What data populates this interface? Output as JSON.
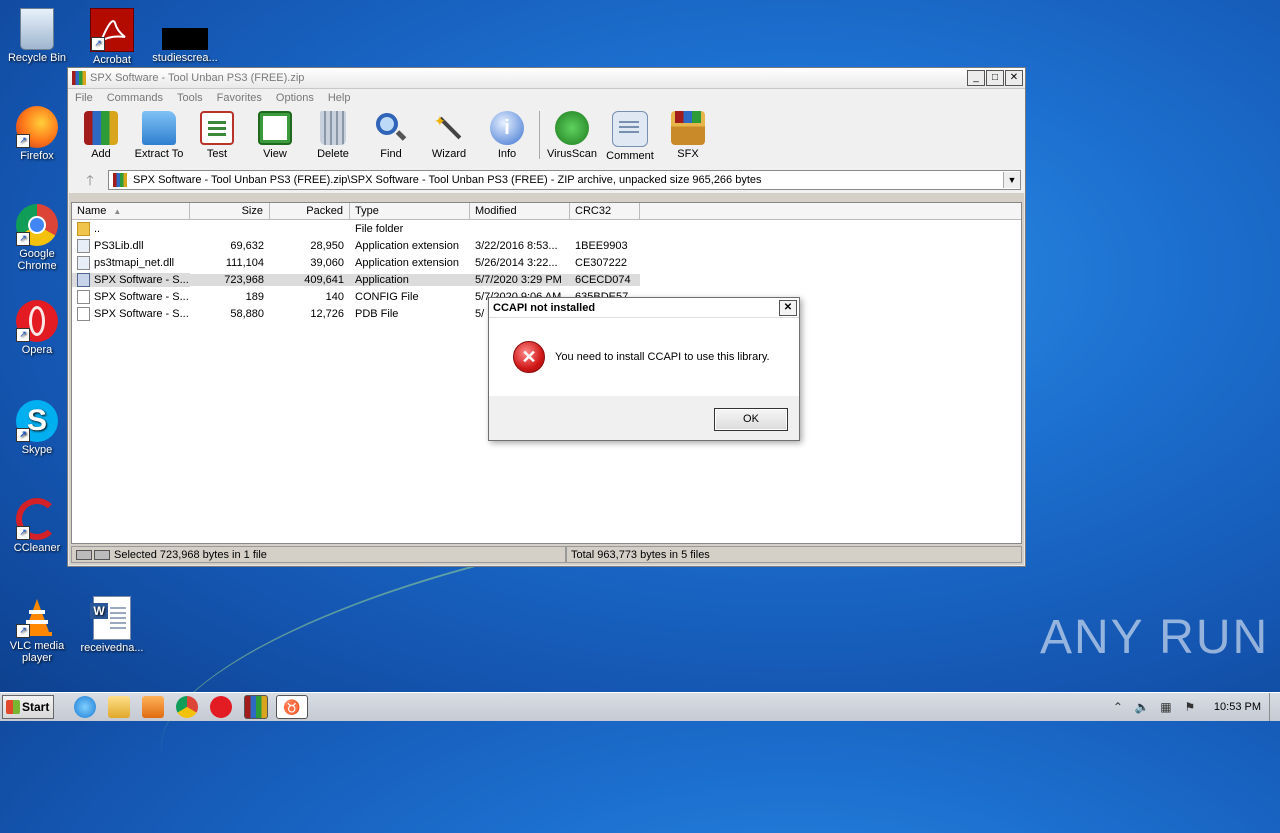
{
  "desktop": {
    "icons": [
      {
        "label": "Recycle Bin"
      },
      {
        "label": "Acrobat"
      },
      {
        "label": "studiescrea..."
      },
      {
        "label": "Firefox"
      },
      {
        "label": "Google Chrome"
      },
      {
        "label": "Opera"
      },
      {
        "label": "Skype"
      },
      {
        "label": "CCleaner"
      },
      {
        "label": "VLC media player"
      },
      {
        "label": "receivedna..."
      }
    ],
    "watermark": "ANY RUN"
  },
  "window": {
    "title": "SPX Software - Tool Unban PS3 (FREE).zip",
    "menu": [
      "File",
      "Commands",
      "Tools",
      "Favorites",
      "Options",
      "Help"
    ],
    "toolbar": [
      "Add",
      "Extract To",
      "Test",
      "View",
      "Delete",
      "Find",
      "Wizard",
      "Info",
      "VirusScan",
      "Comment",
      "SFX"
    ],
    "address": "SPX Software - Tool Unban PS3 (FREE).zip\\SPX Software - Tool Unban PS3 (FREE) - ZIP archive, unpacked size 965,266 bytes",
    "columns": [
      "Name",
      "Size",
      "Packed",
      "Type",
      "Modified",
      "CRC32"
    ],
    "rows": [
      {
        "name": "..",
        "size": "",
        "packed": "",
        "type": "File folder",
        "modified": "",
        "crc": ""
      },
      {
        "name": "PS3Lib.dll",
        "size": "69,632",
        "packed": "28,950",
        "type": "Application extension",
        "modified": "3/22/2016 8:53...",
        "crc": "1BEE9903"
      },
      {
        "name": "ps3tmapi_net.dll",
        "size": "111,104",
        "packed": "39,060",
        "type": "Application extension",
        "modified": "5/26/2014 3:22...",
        "crc": "CE307222"
      },
      {
        "name": "SPX Software - S...",
        "size": "723,968",
        "packed": "409,641",
        "type": "Application",
        "modified": "5/7/2020 3:29 PM",
        "crc": "6CECD074"
      },
      {
        "name": "SPX Software - S...",
        "size": "189",
        "packed": "140",
        "type": "CONFIG File",
        "modified": "5/7/2020 9:06 AM",
        "crc": "635BDE57"
      },
      {
        "name": "SPX Software - S...",
        "size": "58,880",
        "packed": "12,726",
        "type": "PDB File",
        "modified": "5/",
        "crc": ""
      }
    ],
    "status_left": "Selected 723,968 bytes in 1 file",
    "status_right": "Total 963,773 bytes in 5 files"
  },
  "dialog": {
    "title": "CCAPI not installed",
    "message": "You need to install CCAPI to use this library.",
    "ok": "OK"
  },
  "taskbar": {
    "start": "Start",
    "clock": "10:53 PM"
  }
}
